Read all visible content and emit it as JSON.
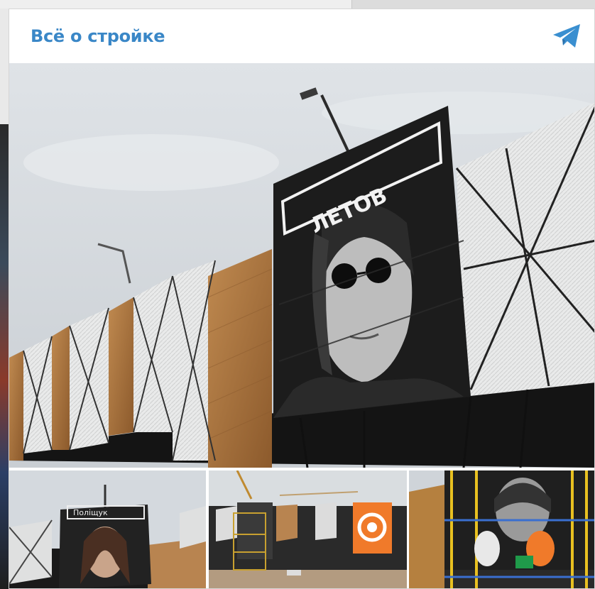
{
  "channel": {
    "title": "Всё о стройке",
    "share_icon": "telegram-icon",
    "accent_color": "#3a87c7"
  },
  "main_photo": {
    "sign_text": "ЛЕТОВ",
    "icon": "photo"
  },
  "thumbnails": [
    {
      "sign_text": "Поліщук"
    },
    {
      "sign_text": ""
    },
    {
      "sign_text": ""
    }
  ]
}
